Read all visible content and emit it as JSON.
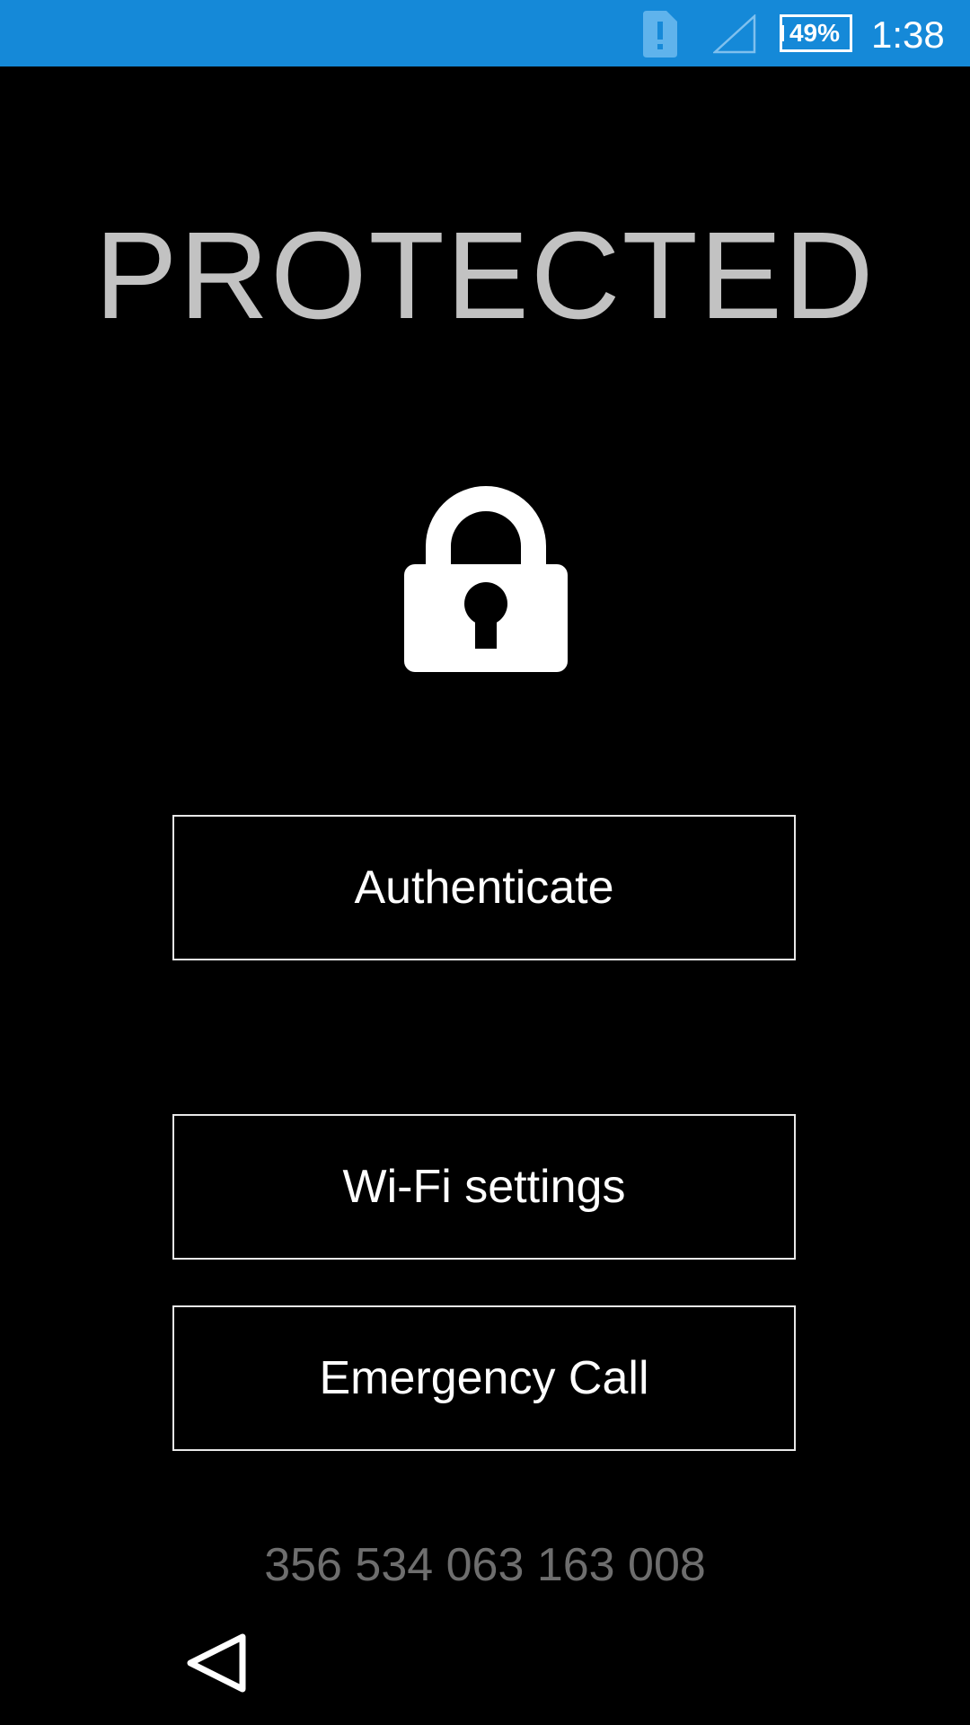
{
  "status_bar": {
    "icons": [
      "sim-alert-icon",
      "signal-icon",
      "battery-icon"
    ],
    "battery_label": "49%",
    "battery_level": 0.49,
    "time": "1:38",
    "background_color": "#1589d8"
  },
  "lock_screen": {
    "title": "PROTECTED",
    "icon": "lock-icon",
    "buttons": {
      "authenticate": "Authenticate",
      "wifi_settings": "Wi-Fi settings",
      "emergency_call": "Emergency Call"
    },
    "device_id": "356 534 063 163 008"
  },
  "nav_bar": {
    "back_icon": "back-triangle-icon"
  }
}
